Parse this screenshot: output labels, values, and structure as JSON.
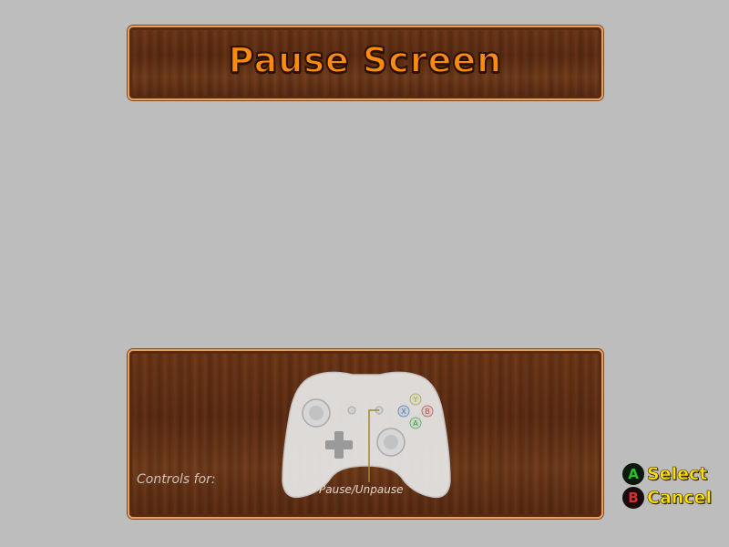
{
  "screen": {
    "title": "Pause Screen"
  },
  "controls": {
    "heading": "Controls for:",
    "mapping_label": "Pause/Unpause",
    "controller_face_buttons": [
      "Y",
      "B",
      "X",
      "A"
    ]
  },
  "hints": [
    {
      "button": "A",
      "label": "Select",
      "color": "#28c028"
    },
    {
      "button": "B",
      "label": "Cancel",
      "color": "#d03030"
    }
  ],
  "colors": {
    "background": "#bdbdbd",
    "title_text": "#ff8a10",
    "panel_border": "#e8a060",
    "hint_text": "#ffe000"
  }
}
